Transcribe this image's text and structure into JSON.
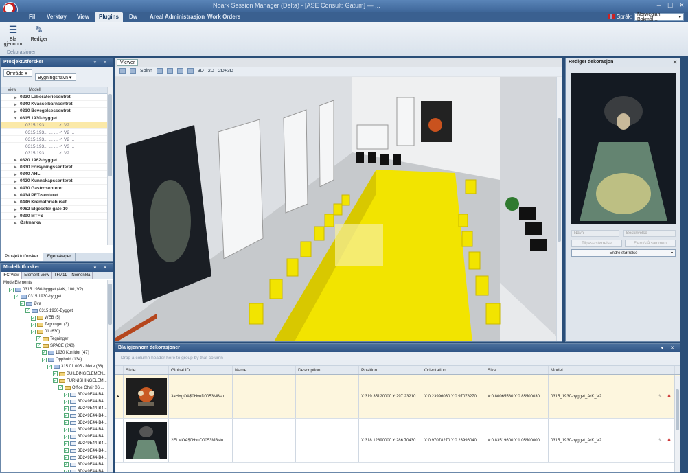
{
  "window": {
    "title": "Noark Session Manager (Delta) - [ASE Consult: Gatum] — ...",
    "controls": [
      "–",
      "□",
      "×"
    ]
  },
  "ribbon": {
    "tabs": [
      "Fil",
      "Verktøy",
      "View",
      "Plugins",
      "Dw",
      "Areal Administrasjon",
      "Work Orders"
    ],
    "active_tab": "Plugins",
    "language_label": "Språk:",
    "language_value": "Norwegian, Bokmål ...",
    "buttons": [
      {
        "label": "Bla gjennom",
        "icon": "list-icon"
      },
      {
        "label": "Rediger",
        "icon": "edit-icon"
      }
    ],
    "group_label": "Dekorasjoner"
  },
  "prosjekt": {
    "title": "Prosjektutforsker",
    "combo_area": "Område",
    "combo_building": "Bygningsnavn",
    "col_view": "View",
    "col_model": "Modell",
    "items": [
      {
        "label": "0230 Laboratoriesentret",
        "expanded": false
      },
      {
        "label": "0240 Kvasselbarnsentret",
        "expanded": false
      },
      {
        "label": "0310 Bevegelsessentret",
        "expanded": false
      },
      {
        "label": "0315 1930-bygget",
        "expanded": true
      }
    ],
    "subitems": [
      {
        "label": "0315 193... ... ... ✓ V2 ...",
        "selected": true
      },
      {
        "label": "0315 193... ... ... ✓ V2 ...",
        "selected": false
      },
      {
        "label": "0315 193... ... ... ✓ V2 ...",
        "selected": false
      },
      {
        "label": "0315 193... ... ... ✓ V3 ...",
        "selected": false
      },
      {
        "label": "0315 193... ... ... ✓ V2 ...",
        "selected": false
      }
    ],
    "items2": [
      "0320 1962-bygget",
      "0330 Forsyningssenteret",
      "0340 AHL",
      "0420 Kunnskapssenteret",
      "0430 Gastrosenteret",
      "0434 PET-senteret",
      "0446 Krematoriehuset",
      "0962 Elgeseter gate 10",
      "9890 MTFS",
      "Østmarka"
    ],
    "bottom_tabs": [
      "Prosjektutforsker",
      "Egenskaper"
    ]
  },
  "modell": {
    "title": "Modellutforsker",
    "tabs": [
      "IFC View",
      "Element View",
      "TFM11",
      "Nomenkla"
    ],
    "rows": [
      {
        "indent": 0,
        "text": "ModelElements",
        "icon": "none"
      },
      {
        "indent": 1,
        "text": "0315 1930-bygget (ArK, 100, V2)",
        "icon": "model"
      },
      {
        "indent": 2,
        "text": "0315 1930-bygget",
        "icon": "model"
      },
      {
        "indent": 3,
        "text": "Øva",
        "icon": "model"
      },
      {
        "indent": 4,
        "text": "0315 1930-Bygget",
        "icon": "model"
      },
      {
        "indent": 5,
        "text": "WEB (5)",
        "icon": "folder"
      },
      {
        "indent": 5,
        "text": "Tegninger (3)",
        "icon": "folder"
      },
      {
        "indent": 5,
        "text": "01 (630)",
        "icon": "folder"
      },
      {
        "indent": 6,
        "text": "Tegninger",
        "icon": "folder"
      },
      {
        "indent": 6,
        "text": "SPACE (240)",
        "icon": "folder"
      },
      {
        "indent": 7,
        "text": "1930 Korridor (47)",
        "icon": "space"
      },
      {
        "indent": 7,
        "text": "Opphold (134)",
        "icon": "space"
      },
      {
        "indent": 8,
        "text": "315.01.005 - Møte (68)",
        "icon": "space"
      },
      {
        "indent": 9,
        "text": "BUILDINGELEMEN...",
        "icon": "folder"
      },
      {
        "indent": 9,
        "text": "FURNISHINGELEM...",
        "icon": "folder"
      },
      {
        "indent": 10,
        "text": "Office Chair 06 ...",
        "icon": "folder"
      },
      {
        "indent": 11,
        "text": "3D249E44-B4...",
        "icon": "item"
      },
      {
        "indent": 11,
        "text": "3D249E44-B4...",
        "icon": "item"
      },
      {
        "indent": 11,
        "text": "3D249E44-B4...",
        "icon": "item"
      },
      {
        "indent": 11,
        "text": "3D249E44-B4...",
        "icon": "item"
      },
      {
        "indent": 11,
        "text": "3D249E44-B4...",
        "icon": "item"
      },
      {
        "indent": 11,
        "text": "3D249E44-B4...",
        "icon": "item"
      },
      {
        "indent": 11,
        "text": "3D249E44-B4...",
        "icon": "item"
      },
      {
        "indent": 11,
        "text": "3D249E44-B4...",
        "icon": "item"
      },
      {
        "indent": 11,
        "text": "3D249E44-B4...",
        "icon": "item"
      },
      {
        "indent": 11,
        "text": "3D249E44-B4...",
        "icon": "item"
      },
      {
        "indent": 11,
        "text": "3D249E44-B4...",
        "icon": "item"
      },
      {
        "indent": 11,
        "text": "3D249E44-B4...",
        "icon": "item"
      },
      {
        "indent": 11,
        "text": "3D249E44-B4...",
        "icon": "item"
      }
    ]
  },
  "viewer": {
    "tab": "Viewer",
    "tools": [
      "Spinn",
      "3D",
      "2D",
      "2D+3D"
    ]
  },
  "dekor": {
    "title": "Rediger dekorasjon",
    "field_left": "Navn",
    "field_right": "Beskrivelse",
    "btn_left": "Tilpass størrelse",
    "btn_right": "Fjern/slå sammen",
    "btn_main": "Endre størrelse"
  },
  "grid": {
    "title": "Bla igjennom dekorasjoner",
    "group_hint": "Drag a column header here to group by that column",
    "columns": [
      "Slide",
      "Global ID",
      "Name",
      "Description",
      "Position",
      "Orientation",
      "Size",
      "Model"
    ],
    "rows": [
      {
        "global_id": "3aHYgOA$0HvuD0053MBstu",
        "name": "",
        "description": "",
        "position": "X:319.35120000 Y:297.23210...",
        "orientation": "X:0.23996030 Y:0.97078270 ...",
        "size": "X:0.80065580 Y:0.85500030",
        "model": "0315_1930-bygget_ArK_V2",
        "selected": true
      },
      {
        "global_id": "2ELMOA$0HvuD0053MBstu",
        "name": "",
        "description": "",
        "position": "X:318.12890000 Y:286.70430...",
        "orientation": "X:0.97078270 Y:0.23996040 ...",
        "size": "X:0.83519600 Y:1.05500000",
        "model": "0315_1930-bygget_ArK_V2",
        "selected": false
      }
    ]
  },
  "colors": {
    "accent": "#2f5586",
    "selection": "#fbe9a8",
    "furniture": "#f2e400"
  }
}
